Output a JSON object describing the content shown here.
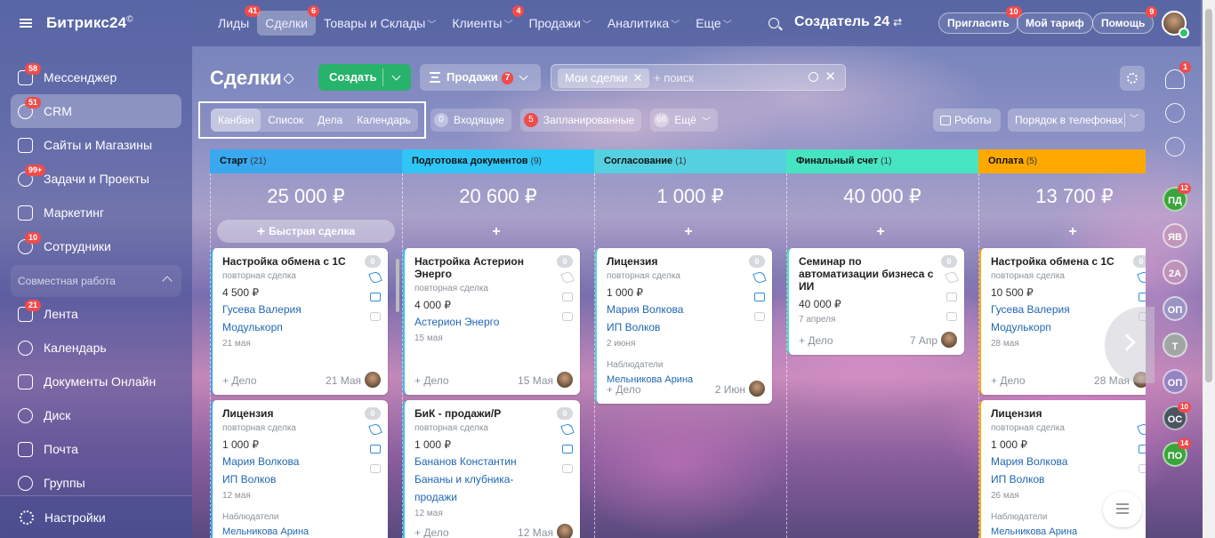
{
  "app": {
    "logo": "Битрикс24",
    "logo_mark": "©"
  },
  "sidebar": {
    "items": [
      {
        "label": "Мессенджер",
        "badge": "58",
        "icon": "messenger-icon"
      },
      {
        "label": "CRM",
        "badge": "51",
        "icon": "crm-icon",
        "active": true
      },
      {
        "label": "Сайты и Магазины",
        "badge": "",
        "icon": "sites-icon"
      },
      {
        "label": "Задачи и Проекты",
        "badge": "99+",
        "icon": "tasks-icon"
      },
      {
        "label": "Маркетинг",
        "badge": "",
        "icon": "marketing-icon"
      },
      {
        "label": "Сотрудники",
        "badge": "10",
        "icon": "employees-icon"
      }
    ],
    "section": "Совместная работа",
    "items2": [
      {
        "label": "Лента",
        "badge": "21",
        "icon": "feed-icon"
      },
      {
        "label": "Календарь",
        "badge": "",
        "icon": "calendar-icon"
      },
      {
        "label": "Документы Онлайн",
        "badge": "",
        "icon": "documents-icon"
      },
      {
        "label": "Диск",
        "badge": "",
        "icon": "disk-icon"
      },
      {
        "label": "Почта",
        "badge": "",
        "icon": "mail-icon"
      },
      {
        "label": "Группы",
        "badge": "",
        "icon": "groups-icon"
      }
    ],
    "settings": "Настройки"
  },
  "topnav": {
    "items": [
      {
        "label": "Лиды",
        "badge": "41"
      },
      {
        "label": "Сделки",
        "badge": "6",
        "active": true
      },
      {
        "label": "Товары и Склады",
        "badge": "",
        "caret": true
      },
      {
        "label": "Клиенты",
        "badge": "4",
        "caret": true
      },
      {
        "label": "Продажи",
        "badge": "",
        "caret": true
      },
      {
        "label": "Аналитика",
        "badge": "",
        "caret": true
      },
      {
        "label": "Еще",
        "badge": "",
        "caret": true
      }
    ],
    "creator": "Создатель 24",
    "invite": "Пригласить",
    "invite_badge": "10",
    "tariff": "Мой тариф",
    "help": "Помощь",
    "help_badge": "9"
  },
  "page": {
    "title": "Сделки",
    "create": "Создать",
    "funnel": "Продажи",
    "funnel_badge": "7",
    "filter_chip": "Мои сделки",
    "search_placeholder": "+ поиск"
  },
  "views": [
    "Канбан",
    "Список",
    "Дела",
    "Календарь"
  ],
  "counters": [
    {
      "n": "0",
      "label": "Входящие",
      "red": false
    },
    {
      "n": "5",
      "label": "Запланированные",
      "red": true
    },
    {
      "n": "66",
      "label": "Ещё",
      "red": false,
      "caret": true
    }
  ],
  "robots": "Роботы",
  "sort": "Порядок в телефонах",
  "columns": [
    {
      "name": "Старт",
      "count": "(21)",
      "color": "#39a8ef",
      "sum": "25 000 ₽",
      "add": "Быстрая сделка",
      "cards": [
        {
          "title": "Настройка обмена с 1С",
          "cnt": "0",
          "type": "повторная сделка",
          "price": "4 500 ₽",
          "links": [
            "Гусева Валерия",
            "Модулькорп"
          ],
          "date": "21 мая",
          "foot_date": "21 Мая",
          "active_icons": true
        },
        {
          "title": "Лицензия",
          "cnt": "0",
          "type": "повторная сделка",
          "price": "1 000 ₽",
          "links": [
            "Мария Волкова",
            "ИП Волков"
          ],
          "date": "12 мая",
          "observers": "Наблюдатели",
          "observer": "Мельникова Арина",
          "active_icons": true
        }
      ]
    },
    {
      "name": "Подготовка документов",
      "count": "(9)",
      "color": "#2fc6f6",
      "sum": "20 600 ₽",
      "add": "",
      "cards": [
        {
          "title": "Настройка Астерион Энерго",
          "cnt": "0",
          "type": "повторная сделка",
          "price": "4 000 ₽",
          "links": [
            "Астерион Энерго"
          ],
          "date": "15 мая",
          "foot_date": "15 Мая",
          "active_icons": false
        },
        {
          "title": "БиК - продажи/Р",
          "cnt": "0",
          "type": "повторная сделка",
          "price": "1 000 ₽",
          "links": [
            "Бананов Константин",
            "Бананы и клубника-",
            "продажи"
          ],
          "date": "12 мая",
          "foot_date": "12 Мая",
          "active_icons": true
        }
      ]
    },
    {
      "name": "Согласование",
      "count": "(1)",
      "color": "#55d0e0",
      "sum": "1 000 ₽",
      "add": "",
      "cards": [
        {
          "title": "Лицензия",
          "cnt": "0",
          "type": "повторная сделка",
          "price": "1 000 ₽",
          "links": [
            "Мария Волкова",
            "ИП Волков"
          ],
          "date": "2 июня",
          "observers": "Наблюдатели",
          "observer": "Мельникова Арина",
          "foot_date": "2 Июн",
          "active_icons": true
        }
      ]
    },
    {
      "name": "Финальный счет",
      "count": "(1)",
      "color": "#47e4c2",
      "sum": "40 000 ₽",
      "add": "",
      "cards": [
        {
          "title": "Семинар по автоматизации бизнеса с ИИ",
          "cnt": "0",
          "type": "",
          "price": "40 000 ₽",
          "links": [],
          "date": "7 апреля",
          "foot_date": "7 Апр",
          "active_icons": false
        }
      ]
    },
    {
      "name": "Оплата",
      "count": "(5)",
      "color": "#ffa900",
      "sum": "13 700 ₽",
      "add": "",
      "cards": [
        {
          "title": "Настройка обмена с 1С",
          "cnt": "0",
          "type": "повторная сделка",
          "price": "10 500 ₽",
          "links": [
            "Гусева Валерия",
            "Модулькорп"
          ],
          "date": "28 мая",
          "foot_date": "28 Мая",
          "active_icons": true
        },
        {
          "title": "Лицензия",
          "cnt": "",
          "type": "повторная сделка",
          "price": "1 000 ₽",
          "links": [
            "Мария Волкова",
            "ИП Волков"
          ],
          "date": "26 мая",
          "observers": "Наблюдатели",
          "observer": "Мельникова Арина",
          "active_icons": true
        }
      ]
    }
  ],
  "card_add_activity": "+ Дело",
  "rightbar": [
    {
      "label": "ПД",
      "badge": "12",
      "color": "#3aa53a"
    },
    {
      "label": "ЯВ",
      "badge": "",
      "color": "rgba(200,150,180,.6)"
    },
    {
      "label": "2А",
      "badge": "",
      "color": "rgba(200,150,180,.6)"
    },
    {
      "label": "ОП",
      "badge": "",
      "color": "rgba(150,160,200,.6)"
    },
    {
      "label": "Т",
      "badge": "",
      "color": "rgba(150,190,150,.6)"
    },
    {
      "label": "ОП",
      "badge": "",
      "color": "rgba(120,130,200,.6)"
    },
    {
      "label": "ОС",
      "badge": "10",
      "color": "#4a5560"
    },
    {
      "label": "ПО",
      "badge": "14",
      "color": "#3aa53a"
    }
  ],
  "bell_badge": "1"
}
